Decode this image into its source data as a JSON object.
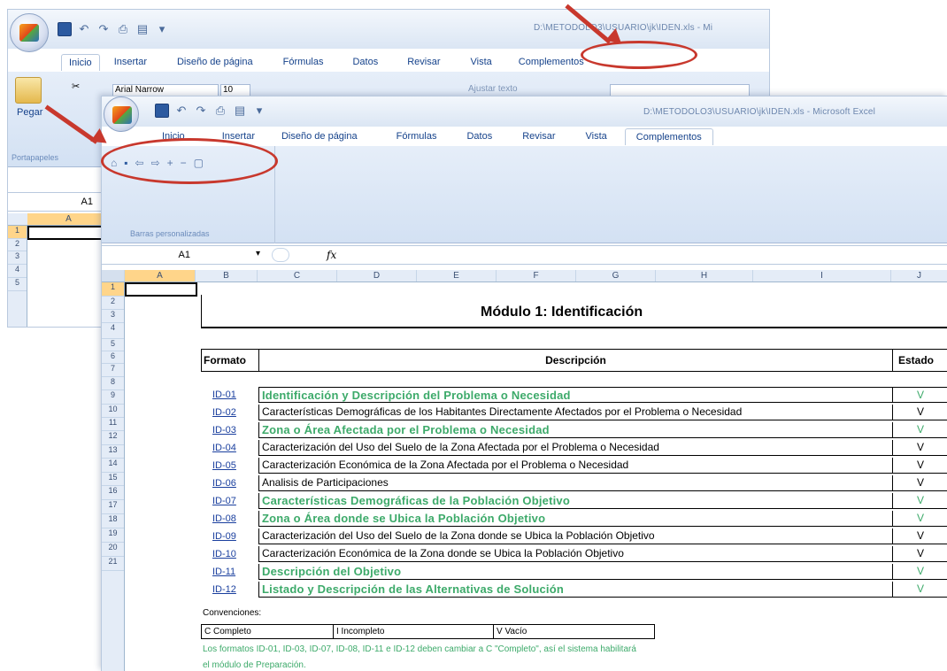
{
  "back_window": {
    "title": "D:\\METODOLO3\\USUARIO\\jk\\IDEN.xls - Mi",
    "tabs": [
      "Inicio",
      "Insertar",
      "Diseño de página",
      "Fórmulas",
      "Datos",
      "Revisar",
      "Vista",
      "Complementos"
    ],
    "font_name": "Arial Narrow",
    "font_size": "10",
    "wrap_text": "Ajustar texto",
    "paste_label": "Pegar",
    "clipboard_group": "Portapapeles",
    "name_box": "A1",
    "column_a": "A",
    "rows": [
      "1",
      "2",
      "3",
      "4",
      "5"
    ]
  },
  "front_window": {
    "title": "D:\\METODOLO3\\USUARIO\\jk\\IDEN.xls - Microsoft Excel",
    "tabs": [
      "Inicio",
      "Insertar",
      "Diseño de página",
      "Fórmulas",
      "Datos",
      "Revisar",
      "Vista",
      "Complementos"
    ],
    "active_tab": "Complementos",
    "group_label": "Barras personalizadas",
    "name_box": "A1",
    "fx": "fx",
    "columns": [
      "A",
      "B",
      "C",
      "D",
      "E",
      "F",
      "G",
      "H",
      "I",
      "J"
    ],
    "rows": [
      "1",
      "2",
      "3",
      "4",
      "5",
      "6",
      "7",
      "8",
      "9",
      "10",
      "11",
      "12",
      "13",
      "14",
      "15",
      "16",
      "17",
      "18",
      "19",
      "20",
      "21"
    ]
  },
  "sheet": {
    "title": "Módulo 1: Identificación",
    "header_formato": "Formato",
    "header_descripcion": "Descripción",
    "header_estado": "Estado",
    "formats": [
      {
        "code": "ID-01",
        "desc": "Identificación y Descripción del Problema o Necesidad",
        "state": "V",
        "style": "green"
      },
      {
        "code": "ID-02",
        "desc": "Características Demográficas de los Habitantes Directamente Afectados por el Problema o Necesidad",
        "state": "V",
        "style": "black"
      },
      {
        "code": "ID-03",
        "desc": "Zona o Área Afectada por el Problema o Necesidad",
        "state": "V",
        "style": "green"
      },
      {
        "code": "ID-04",
        "desc": "Caracterización del Uso del Suelo de la Zona Afectada por el Problema o Necesidad",
        "state": "V",
        "style": "black"
      },
      {
        "code": "ID-05",
        "desc": "Caracterización Económica de la Zona Afectada por el Problema o Necesidad",
        "state": "V",
        "style": "black"
      },
      {
        "code": "ID-06",
        "desc": "Analisis de Participaciones",
        "state": "V",
        "style": "black"
      },
      {
        "code": "ID-07",
        "desc": "Características Demográficas de la Población Objetivo",
        "state": "V",
        "style": "green"
      },
      {
        "code": "ID-08",
        "desc": "Zona o Área donde se Ubica la Población Objetivo",
        "state": "V",
        "style": "green"
      },
      {
        "code": "ID-09",
        "desc": "Caracterización del Uso del Suelo de la Zona donde se Ubica la Población Objetivo",
        "state": "V",
        "style": "black"
      },
      {
        "code": "ID-10",
        "desc": "Caracterización Económica de la Zona donde se Ubica la Población Objetivo",
        "state": "V",
        "style": "black"
      },
      {
        "code": "ID-11",
        "desc": "Descripción del Objetivo",
        "state": "V",
        "style": "green"
      },
      {
        "code": "ID-12",
        "desc": "Listado y Descripción de las Alternativas de Solución",
        "state": "V",
        "style": "green"
      }
    ],
    "conventions_label": "Convenciones:",
    "conv_c": "C  Completo",
    "conv_i": "I  Incompleto",
    "conv_v": "V  Vacío",
    "note_line1": "Los formatos ID-01, ID-03, ID-07, ID-08, ID-11 e ID-12 deben cambiar a C \"Completo\", así el sistema habilitará",
    "note_line2": "el módulo de Preparación."
  },
  "colors": {
    "annotation": "#c8382d",
    "green_text": "#3daa6a",
    "link_blue": "#1a3f9e"
  }
}
